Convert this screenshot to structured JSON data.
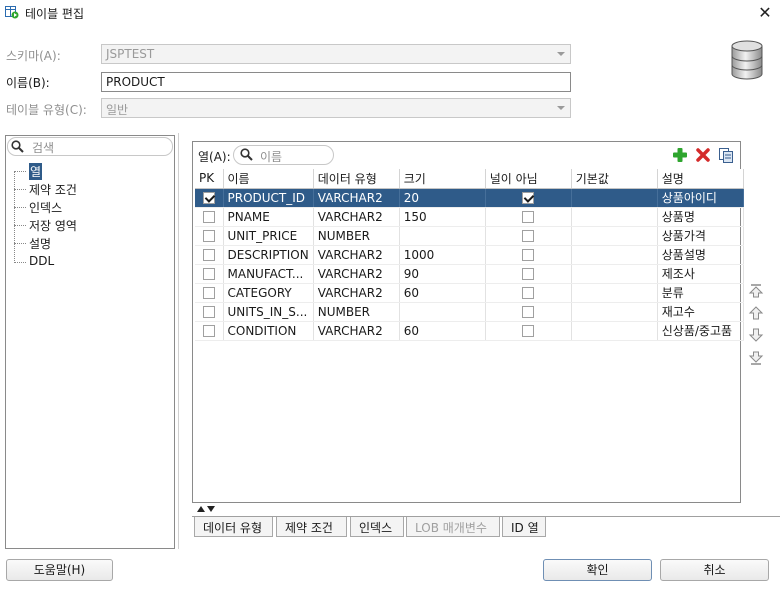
{
  "window": {
    "title": "테이블 편집",
    "close_glyph": "✕"
  },
  "form": {
    "schema_label": "스키마(A):",
    "schema_value": "JSPTEST",
    "name_label": "이름(B):",
    "name_value": "PRODUCT",
    "type_label": "테이블 유형(C):",
    "type_value": "일반"
  },
  "left_panel": {
    "search_placeholder": "검색",
    "items": [
      "열",
      "제약 조건",
      "인덱스",
      "저장 영역",
      "설명",
      "DDL"
    ],
    "selected_index": 0
  },
  "columns_panel": {
    "label": "열(A):",
    "search_placeholder": "이름",
    "headers": [
      "PK",
      "이름",
      "데이터 유형",
      "크기",
      "널이 아님",
      "기본값",
      "설명"
    ],
    "rows": [
      {
        "pk": true,
        "name": "PRODUCT_ID",
        "type": "VARCHAR2",
        "size": "20",
        "not_null": true,
        "default": "",
        "comment": "상품아이디"
      },
      {
        "pk": false,
        "name": "PNAME",
        "type": "VARCHAR2",
        "size": "150",
        "not_null": false,
        "default": "",
        "comment": "상품명"
      },
      {
        "pk": false,
        "name": "UNIT_PRICE",
        "type": "NUMBER",
        "size": "",
        "not_null": false,
        "default": "",
        "comment": "상품가격"
      },
      {
        "pk": false,
        "name": "DESCRIPTION",
        "type": "VARCHAR2",
        "size": "1000",
        "not_null": false,
        "default": "",
        "comment": "상품설명"
      },
      {
        "pk": false,
        "name": "MANUFACT...",
        "type": "VARCHAR2",
        "size": "90",
        "not_null": false,
        "default": "",
        "comment": "제조사"
      },
      {
        "pk": false,
        "name": "CATEGORY",
        "type": "VARCHAR2",
        "size": "60",
        "not_null": false,
        "default": "",
        "comment": "분류"
      },
      {
        "pk": false,
        "name": "UNITS_IN_S...",
        "type": "NUMBER",
        "size": "",
        "not_null": false,
        "default": "",
        "comment": "재고수"
      },
      {
        "pk": false,
        "name": "CONDITION",
        "type": "VARCHAR2",
        "size": "60",
        "not_null": false,
        "default": "",
        "comment": "신상품/중고품"
      }
    ],
    "selected_row": 0,
    "toolbar_icons": [
      "add-icon",
      "delete-icon",
      "copy-icon"
    ]
  },
  "bottom_tabs": [
    "데이터 유형",
    "제약 조건",
    "인덱스",
    "LOB 매개변수",
    "ID 열"
  ],
  "disabled_tab_index": 3,
  "buttons": {
    "help": "도움말(H)",
    "ok": "확인",
    "cancel": "취소"
  },
  "colors": {
    "selection": "#2f5b89",
    "add_green": "#2ea52e",
    "delete_red": "#d42b2b"
  }
}
